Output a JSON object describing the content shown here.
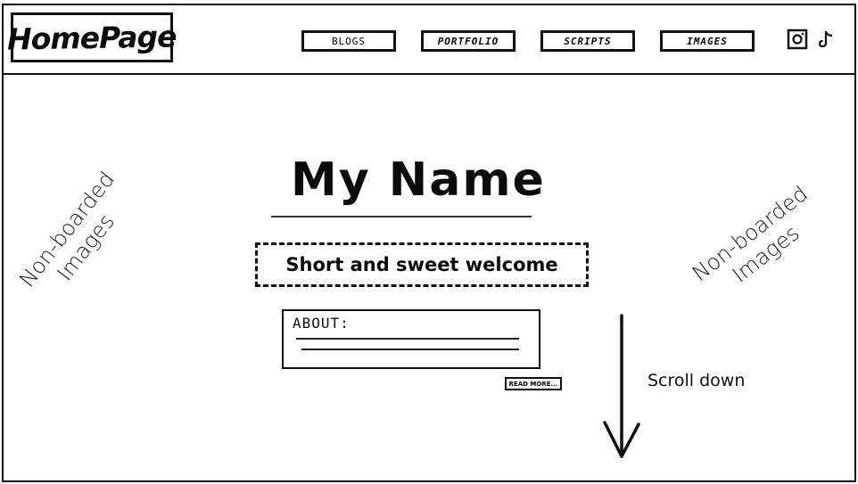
{
  "header": {
    "logo": "HomePage",
    "nav": [
      {
        "label": "BLOGS"
      },
      {
        "label": "PORTFOLIO"
      },
      {
        "label": "SCRIPTS"
      },
      {
        "label": "IMAGES"
      }
    ],
    "social": {
      "instagram_icon": "instagram-icon",
      "tiktok_icon": "tiktok-icon"
    }
  },
  "main": {
    "title": "My Name",
    "welcome": "Short and sweet welcome",
    "about_label": "ABOUT:",
    "read_more": "READ MORE..."
  },
  "notes": {
    "left_line1": "Non-boarded",
    "left_line2": "Images",
    "right_line1": "Non-boarded",
    "right_line2": "Images",
    "scroll": "Scroll down"
  },
  "colors": {
    "ink": "#111111",
    "background": "#ffffff"
  }
}
